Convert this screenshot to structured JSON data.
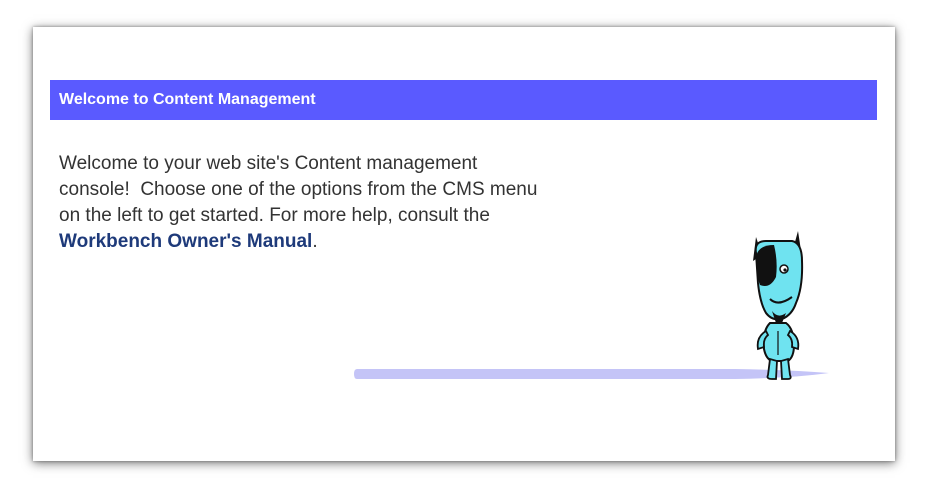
{
  "header": {
    "title": "Welcome to Content Management"
  },
  "intro": {
    "line1": "Welcome to your web site's Content management",
    "line2": "console!  Choose one of the options from the CMS menu",
    "line3": "on the left to get started. For more help, consult the",
    "link_label": "Workbench Owner's Manual",
    "trailing": "."
  },
  "colors": {
    "header_bg": "#5a5aff",
    "link": "#1e3a7a",
    "shadow_bar": "#c4c4f7",
    "mascot_body": "#6fe3f0"
  },
  "icons": {
    "mascot": "dog-mascot-icon"
  }
}
